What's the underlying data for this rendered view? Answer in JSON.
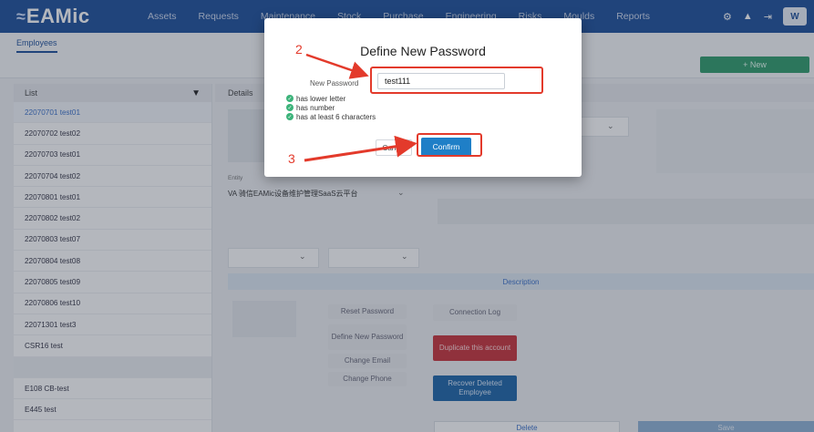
{
  "app": {
    "logo": "EAMic",
    "nav": [
      "Assets",
      "Requests",
      "Maintenance",
      "Stock",
      "Purchase",
      "Engineering",
      "Risks",
      "Moulds",
      "Reports"
    ],
    "brand_short": "W"
  },
  "subheader": {
    "tab": "Employees",
    "new_button": "+ New"
  },
  "list": {
    "header": "List",
    "items": [
      "22070701 test01",
      "22070702 test02",
      "22070703 test01",
      "22070704 test02",
      "22070801 test01",
      "22070802 test02",
      "22070803 test07",
      "22070804 test08",
      "22070805 test09",
      "22070806 test10",
      "22071301 test3",
      "CSR16 test",
      "",
      "E108 CB-test",
      "E445 test"
    ]
  },
  "details": {
    "header": "Details",
    "entity_label": "Entity",
    "entity_value": "VA 骑信EAMic设备维护管理SaaS云平台",
    "description_tab": "Description",
    "actions": {
      "reset_password": "Reset Password",
      "define_new_password": "Define New Password",
      "change_email": "Change Email",
      "change_phone": "Change Phone",
      "connection_log": "Connection Log",
      "duplicate_account": "Duplicate this account",
      "recover_deleted": "Recover Deleted Employee"
    },
    "bottom": {
      "delete": "Delete",
      "save": "Save"
    }
  },
  "modal": {
    "title": "Define New Password",
    "label": "New Password",
    "value": "test111",
    "rules": [
      "has lower letter",
      "has number",
      "has at least 6 characters"
    ],
    "cancel": "Cancel",
    "confirm": "Confirm"
  },
  "annotations": {
    "step2": "2",
    "step3": "3",
    "color": "#e33a2b"
  },
  "colors": {
    "primary": "#1d4f9a",
    "accent_green": "#2e9b6a",
    "danger": "#c8323a",
    "confirm": "#1f7fc7"
  }
}
